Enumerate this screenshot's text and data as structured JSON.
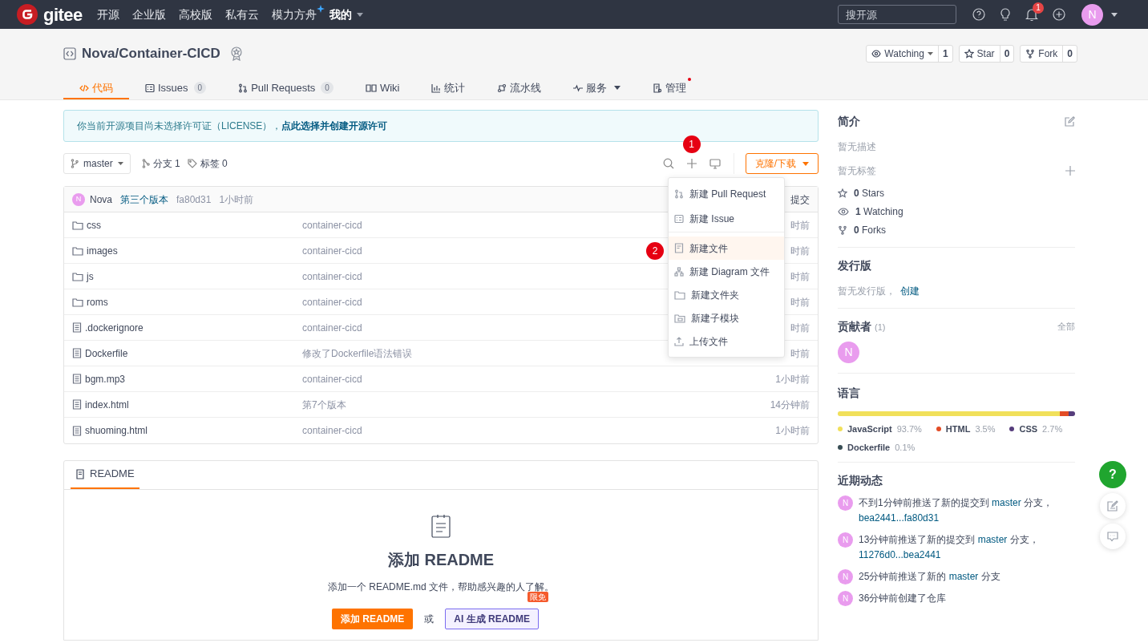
{
  "nav": {
    "brand": "gitee",
    "links": [
      {
        "label": "开源",
        "sparkle": false,
        "dropdown": false
      },
      {
        "label": "企业版",
        "sparkle": false,
        "dropdown": false
      },
      {
        "label": "高校版",
        "sparkle": false,
        "dropdown": false
      },
      {
        "label": "私有云",
        "sparkle": false,
        "dropdown": false
      },
      {
        "label": "模力方舟",
        "sparkle": true,
        "dropdown": false
      },
      {
        "label": "我的",
        "sparkle": false,
        "dropdown": true
      }
    ],
    "search": {
      "placeholder": "搜开源"
    },
    "notification_count": "1",
    "avatar": "N"
  },
  "repo": {
    "title": "Nova/Container-CICD",
    "actions": [
      {
        "label": "Watching",
        "count": "1",
        "dropdown": true
      },
      {
        "label": "Star",
        "count": "0",
        "dropdown": false
      },
      {
        "label": "Fork",
        "count": "0",
        "dropdown": false
      }
    ],
    "tabs": [
      {
        "label": "代码",
        "dropdown": false,
        "dot": false,
        "selected": true
      },
      {
        "label": "Issues",
        "count": "0",
        "dropdown": false,
        "dot": false,
        "selected": false
      },
      {
        "label": "Pull Requests",
        "count": "0",
        "dropdown": false,
        "dot": false,
        "selected": false
      },
      {
        "label": "Wiki",
        "dropdown": false,
        "dot": false,
        "selected": false
      },
      {
        "label": "统计",
        "dropdown": false,
        "dot": false,
        "selected": false
      },
      {
        "label": "流水线",
        "dropdown": false,
        "dot": false,
        "selected": false
      },
      {
        "label": "服务",
        "dropdown": true,
        "dot": false,
        "selected": false
      },
      {
        "label": "管理",
        "dropdown": false,
        "dot": true,
        "selected": false
      }
    ]
  },
  "notice": {
    "text": "你当前开源项目尚未选择许可证（LICENSE），",
    "link": "点此选择并创建开源许可"
  },
  "toolbar": {
    "branch": "master",
    "branches": "分支 1",
    "tags": "标签 0",
    "clone_button": "克隆/下载",
    "step_badge": "1"
  },
  "commit": {
    "avatar": "N",
    "author": "Nova",
    "message": "第三个版本",
    "hash": "fa80d31",
    "time": "1小时前",
    "column_header": "提交"
  },
  "files": [
    {
      "kind": "folder",
      "name": "css",
      "message": "container-cicd",
      "time": "时前"
    },
    {
      "kind": "folder",
      "name": "images",
      "message": "container-cicd",
      "time": "时前"
    },
    {
      "kind": "folder",
      "name": "js",
      "message": "container-cicd",
      "time": "时前"
    },
    {
      "kind": "folder",
      "name": "roms",
      "message": "container-cicd",
      "time": "时前"
    },
    {
      "kind": "file",
      "name": ".dockerignore",
      "message": "container-cicd",
      "time": "时前"
    },
    {
      "kind": "file",
      "name": "Dockerfile",
      "message": "修改了Dockerfile语法错误",
      "time": "时前"
    },
    {
      "kind": "file",
      "name": "bgm.mp3",
      "message": "container-cicd",
      "time": "1小时前"
    },
    {
      "kind": "file",
      "name": "index.html",
      "message": "第7个版本",
      "time": "14分钟前"
    },
    {
      "kind": "file",
      "name": "shuoming.html",
      "message": "container-cicd",
      "time": "1小时前"
    }
  ],
  "create_menu": {
    "step_badge": "2",
    "items": [
      {
        "label": "新建 Pull Request",
        "highlighted": false,
        "divider_after": false
      },
      {
        "label": "新建 Issue",
        "highlighted": false,
        "divider_after": true
      },
      {
        "label": "新建文件",
        "highlighted": true,
        "divider_after": false
      },
      {
        "label": "新建 Diagram 文件",
        "highlighted": false,
        "divider_after": false
      },
      {
        "label": "新建文件夹",
        "highlighted": false,
        "divider_after": false
      },
      {
        "label": "新建子模块",
        "highlighted": false,
        "divider_after": false
      },
      {
        "label": "上传文件",
        "highlighted": false,
        "divider_after": false
      }
    ]
  },
  "readme": {
    "tab": "README",
    "title": "添加 README",
    "description": "添加一个 README.md 文件，帮助感兴趣的人了解。",
    "add_button": "添加 README",
    "or": "或",
    "ai_button": "AI 生成 README",
    "ai_badge": "限免"
  },
  "sidebar": {
    "intro_title": "简介",
    "description": "暂无描述",
    "tags": "暂无标签",
    "stats": [
      {
        "count": "0",
        "label": "Stars"
      },
      {
        "count": "1",
        "label": "Watching"
      },
      {
        "count": "0",
        "label": "Forks"
      }
    ],
    "releases_title": "发行版",
    "releases_text": "暂无发行版，",
    "releases_link": "创建",
    "contributors_title": "贡献者",
    "contributors_count": "(1)",
    "contributors_all": "全部",
    "contributors": [
      "N"
    ],
    "languages_title": "语言",
    "languages": [
      {
        "name": "JavaScript",
        "percent": "93.7%",
        "color": "#f1e05a"
      },
      {
        "name": "HTML",
        "percent": "3.5%",
        "color": "#e34c26"
      },
      {
        "name": "CSS",
        "percent": "2.7%",
        "color": "#563d7c"
      },
      {
        "name": "Dockerfile",
        "percent": "0.1%",
        "color": "#384d54"
      }
    ],
    "activity_title": "近期动态",
    "activity": [
      {
        "avatar": "N",
        "parts": [
          {
            "text": "不到1分钟前推送了新的提交到 ",
            "link": false
          },
          {
            "text": "master",
            "link": true
          },
          {
            "text": " 分支，",
            "link": false
          },
          {
            "text": "bea2441...fa80d31",
            "link": true
          }
        ]
      },
      {
        "avatar": "N",
        "parts": [
          {
            "text": "13分钟前推送了新的提交到 ",
            "link": false
          },
          {
            "text": "master",
            "link": true
          },
          {
            "text": " 分支，",
            "link": false
          },
          {
            "text": "11276d0...bea2441",
            "link": true
          }
        ]
      },
      {
        "avatar": "N",
        "parts": [
          {
            "text": "25分钟前推送了新的 ",
            "link": false
          },
          {
            "text": "master",
            "link": true
          },
          {
            "text": " 分支",
            "link": false
          }
        ]
      },
      {
        "avatar": "N",
        "parts": [
          {
            "text": "36分钟前创建了仓库",
            "link": false
          }
        ]
      }
    ]
  },
  "floating": {
    "help": "?"
  }
}
